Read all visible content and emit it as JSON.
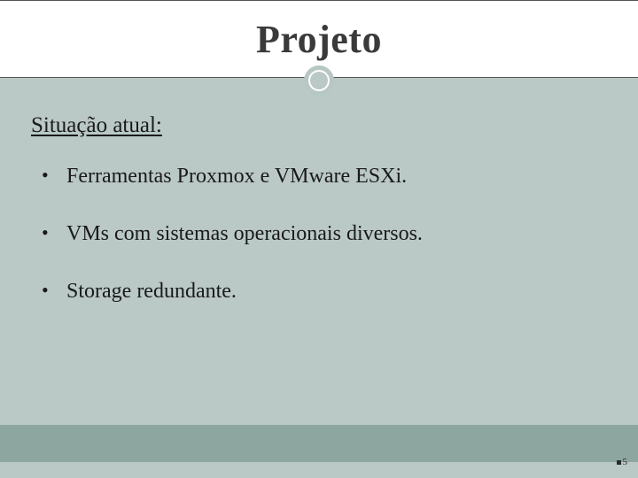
{
  "colors": {
    "slide_bg": "#bac9c6",
    "title_band_bg": "#ffffff",
    "footer_bar": "#8ea6a0",
    "text": "#1a1a1a"
  },
  "title": "Projeto",
  "subheading": "Situação atual:",
  "bullets": [
    "Ferramentas Proxmox e VMware ESXi.",
    "VMs com sistemas operacionais diversos.",
    "Storage redundante."
  ],
  "page_number": "5"
}
